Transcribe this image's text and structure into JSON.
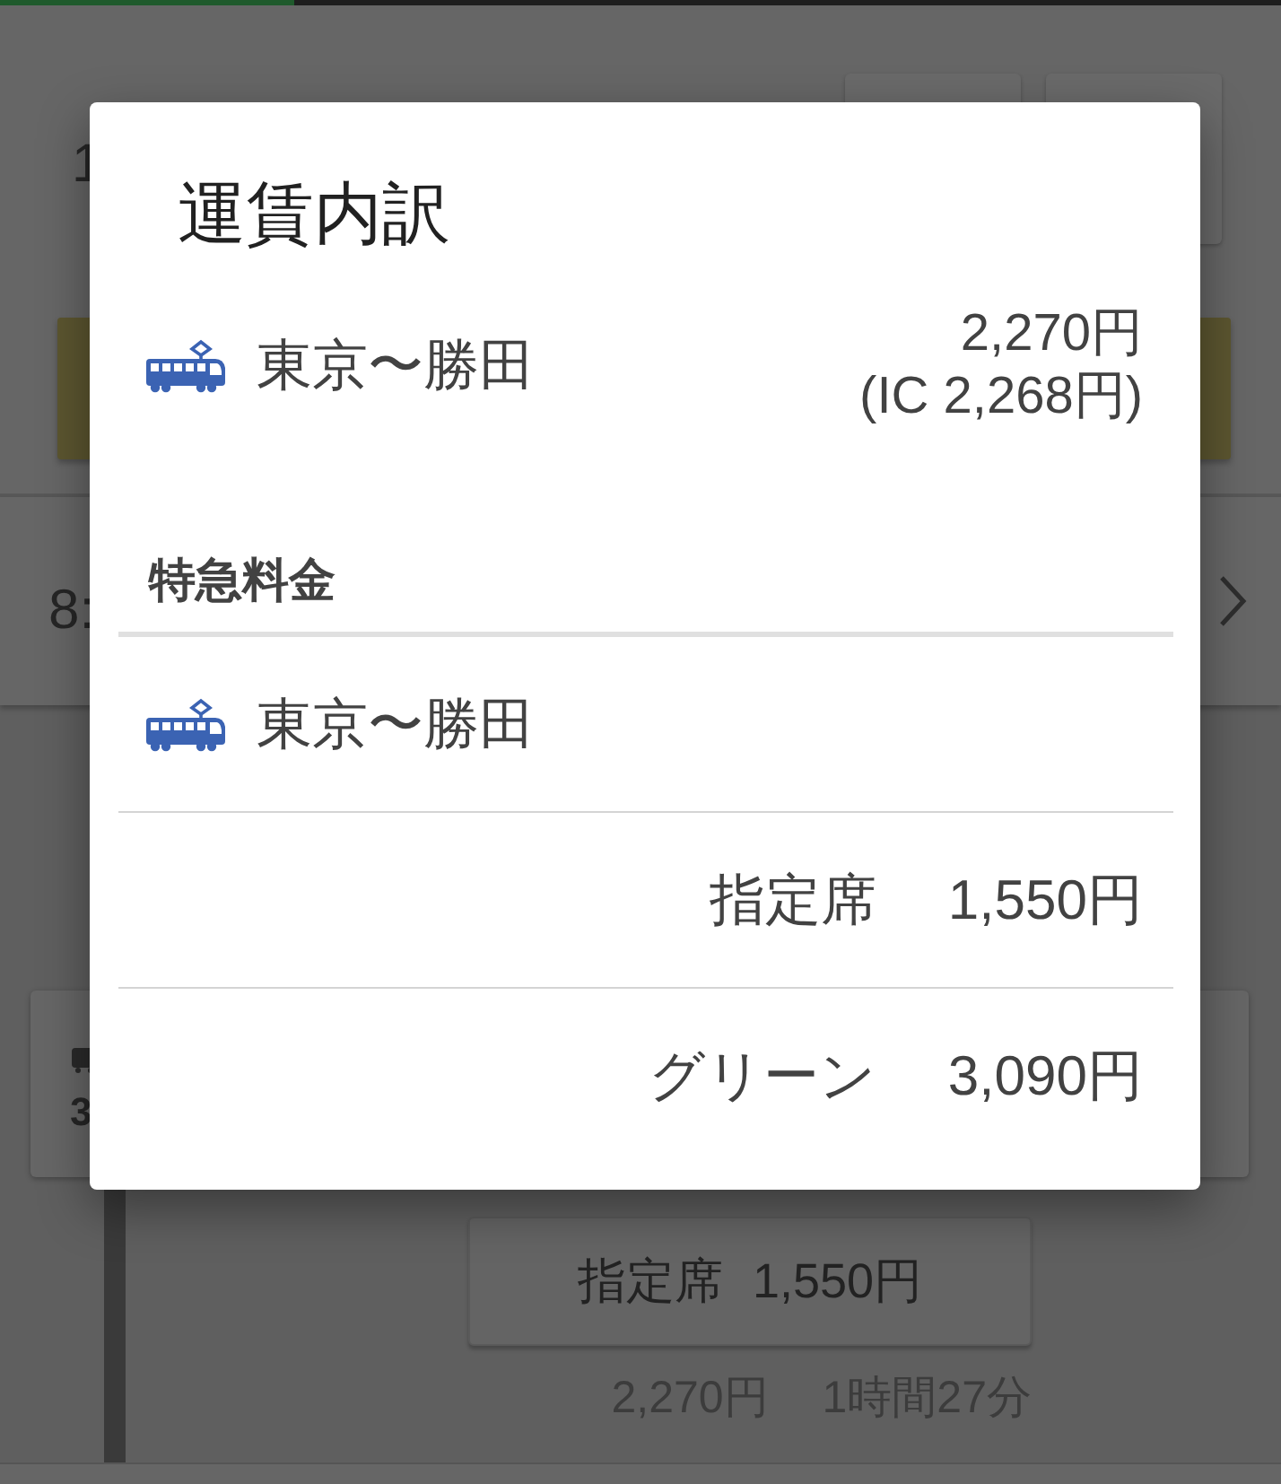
{
  "background": {
    "loading_bar": {
      "level": 0.23
    },
    "header": {
      "number": "1"
    },
    "result_row": {
      "time": "8:"
    },
    "card": {
      "count": "3"
    },
    "seat_button": "指定席 1,550円",
    "fare": "2,270円",
    "duration": "1時間27分"
  },
  "dialog": {
    "title": "運賃内訳",
    "fare": {
      "route": "東京〜勝田",
      "price": "2,270円",
      "ic_price": "(IC 2,268円)"
    },
    "surcharge": {
      "heading": "特急料金",
      "route": "東京〜勝田",
      "seats": [
        {
          "type": "指定席",
          "price": "1,550円"
        },
        {
          "type": "グリーン",
          "price": "3,090円"
        }
      ]
    }
  }
}
